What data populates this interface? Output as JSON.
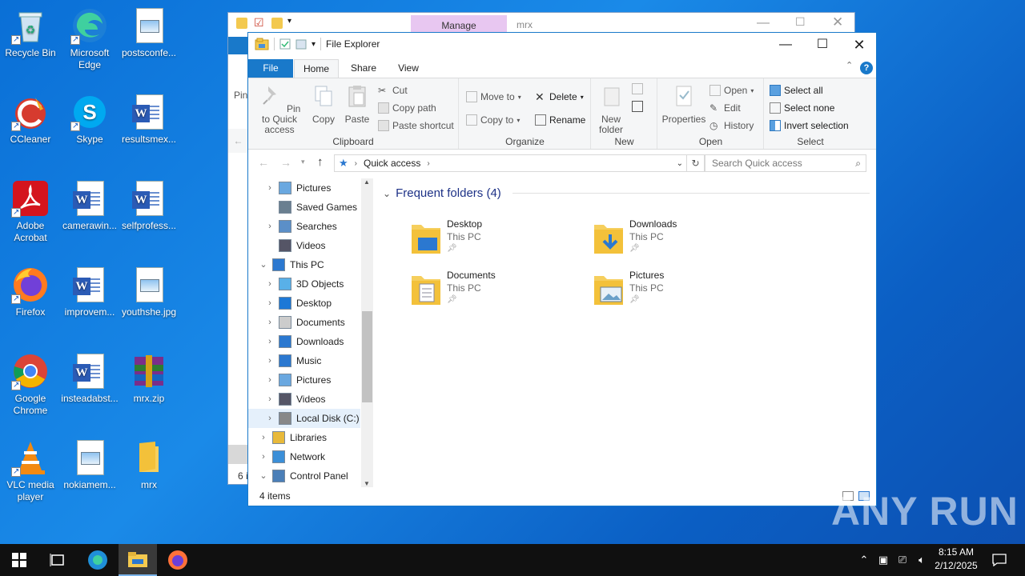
{
  "desktop": {
    "icons": [
      {
        "label": "Recycle Bin",
        "icon": "recycle-bin-icon"
      },
      {
        "label": "Microsoft Edge",
        "icon": "edge-icon"
      },
      {
        "label": "postsconfe...",
        "icon": "image-file-icon"
      },
      {
        "label": "CCleaner",
        "icon": "ccleaner-icon"
      },
      {
        "label": "Skype",
        "icon": "skype-icon"
      },
      {
        "label": "resultsmex...",
        "icon": "word-doc-icon"
      },
      {
        "label": "Adobe Acrobat",
        "icon": "acrobat-icon"
      },
      {
        "label": "camerawin...",
        "icon": "word-doc-icon"
      },
      {
        "label": "selfprofess...",
        "icon": "word-doc-icon"
      },
      {
        "label": "Firefox",
        "icon": "firefox-icon"
      },
      {
        "label": "improvem...",
        "icon": "word-doc-icon"
      },
      {
        "label": "youthshe.jpg",
        "icon": "image-file-icon"
      },
      {
        "label": "Google Chrome",
        "icon": "chrome-icon"
      },
      {
        "label": "insteadabst...",
        "icon": "word-doc-icon"
      },
      {
        "label": "mrx.zip",
        "icon": "winrar-archive-icon"
      },
      {
        "label": "VLC media player",
        "icon": "vlc-icon"
      },
      {
        "label": "nokiamem...",
        "icon": "image-file-icon"
      },
      {
        "label": "mrx",
        "icon": "folder-icon"
      }
    ]
  },
  "background_window": {
    "context_tab": "Manage",
    "title": "mrx",
    "status_partial": "6 i",
    "left_partial": "Pin"
  },
  "window": {
    "title": "File Explorer",
    "tabs": [
      "File",
      "Home",
      "Share",
      "View"
    ],
    "ribbon": {
      "clipboard": {
        "label": "Clipboard",
        "pin": "Pin to Quick access",
        "copy": "Copy",
        "paste": "Paste",
        "cut": "Cut",
        "copy_path": "Copy path",
        "paste_shortcut": "Paste shortcut"
      },
      "organize": {
        "label": "Organize",
        "move_to": "Move to",
        "copy_to": "Copy to",
        "delete": "Delete",
        "rename": "Rename"
      },
      "new": {
        "label": "New",
        "new_folder": "New folder"
      },
      "open": {
        "label": "Open",
        "properties": "Properties",
        "open": "Open",
        "edit": "Edit",
        "history": "History"
      },
      "select": {
        "label": "Select",
        "select_all": "Select all",
        "select_none": "Select none",
        "invert": "Invert selection"
      }
    },
    "address": {
      "path": "Quick access",
      "search_placeholder": "Search Quick access"
    },
    "nav": [
      {
        "label": "Pictures",
        "indent": 1,
        "chev": "›"
      },
      {
        "label": "Saved Games",
        "indent": 1,
        "chev": ""
      },
      {
        "label": "Searches",
        "indent": 1,
        "chev": "›"
      },
      {
        "label": "Videos",
        "indent": 1,
        "chev": ""
      },
      {
        "label": "This PC",
        "indent": 0,
        "chev": "⌄"
      },
      {
        "label": "3D Objects",
        "indent": 1,
        "chev": "›"
      },
      {
        "label": "Desktop",
        "indent": 1,
        "chev": "›"
      },
      {
        "label": "Documents",
        "indent": 1,
        "chev": "›"
      },
      {
        "label": "Downloads",
        "indent": 1,
        "chev": "›"
      },
      {
        "label": "Music",
        "indent": 1,
        "chev": "›"
      },
      {
        "label": "Pictures",
        "indent": 1,
        "chev": "›"
      },
      {
        "label": "Videos",
        "indent": 1,
        "chev": "›"
      },
      {
        "label": "Local Disk (C:)",
        "indent": 1,
        "chev": "›"
      },
      {
        "label": "Libraries",
        "indent": 0,
        "chev": "›"
      },
      {
        "label": "Network",
        "indent": 0,
        "chev": "›"
      },
      {
        "label": "Control Panel",
        "indent": 0,
        "chev": "⌄"
      }
    ],
    "content": {
      "section_title": "Frequent folders (4)",
      "folders": [
        {
          "name": "Desktop",
          "location": "This PC"
        },
        {
          "name": "Downloads",
          "location": "This PC"
        },
        {
          "name": "Documents",
          "location": "This PC"
        },
        {
          "name": "Pictures",
          "location": "This PC"
        }
      ]
    },
    "status": "4 items"
  },
  "taskbar": {
    "time": "8:15 AM",
    "date": "2/12/2025"
  },
  "watermark": "ANY RUN"
}
